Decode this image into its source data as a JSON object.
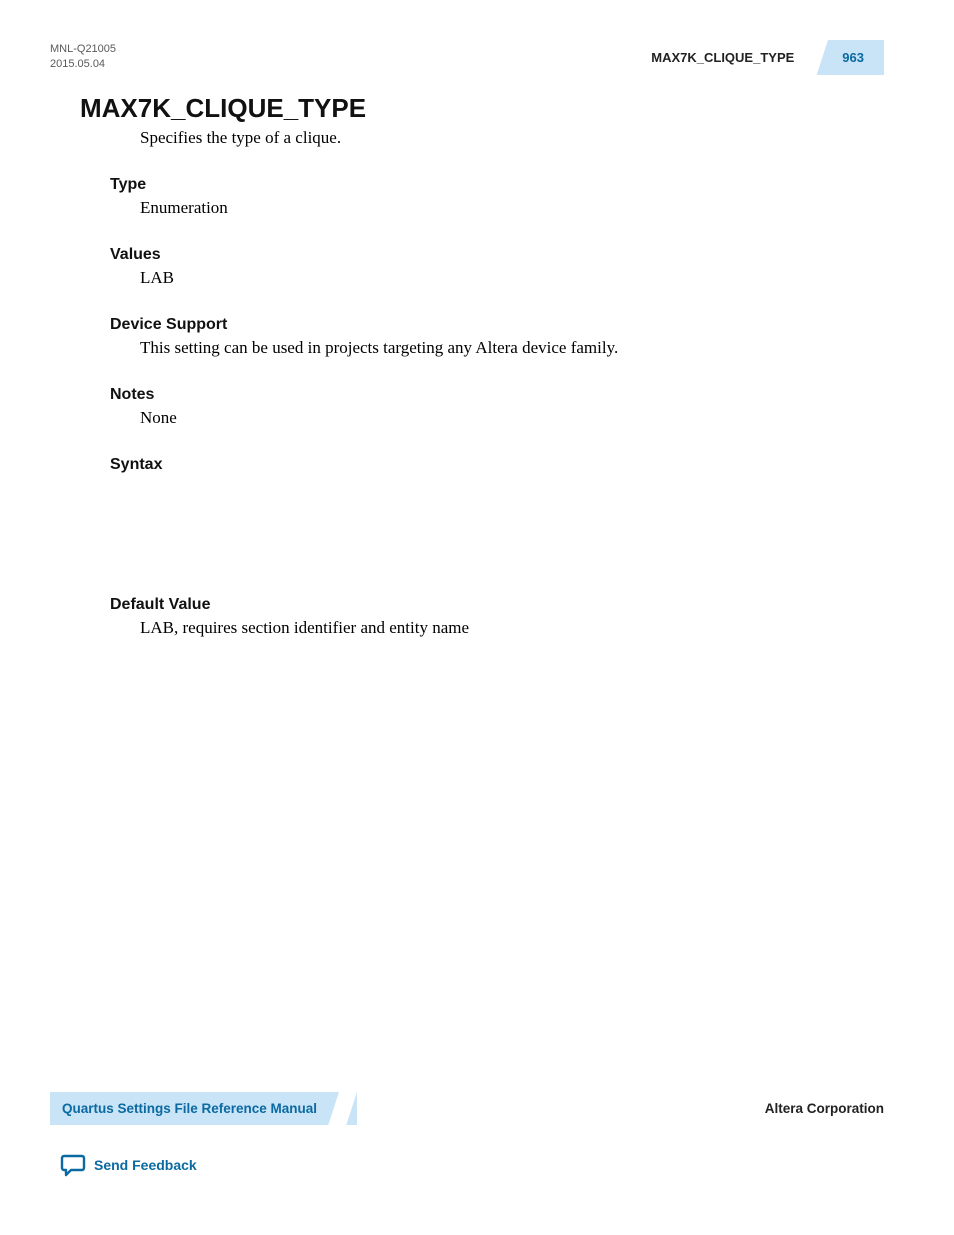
{
  "header": {
    "doc_id": "MNL-Q21005",
    "date": "2015.05.04",
    "running_title": "MAX7K_CLIQUE_TYPE",
    "page_number": "963"
  },
  "title": "MAX7K_CLIQUE_TYPE",
  "intro": "Specifies the type of a clique.",
  "sections": {
    "type": {
      "heading": "Type",
      "body": "Enumeration"
    },
    "values": {
      "heading": "Values",
      "body": "LAB"
    },
    "device_support": {
      "heading": "Device Support",
      "body": "This setting can be used in projects targeting any Altera device family."
    },
    "notes": {
      "heading": "Notes",
      "body": "None"
    },
    "syntax": {
      "heading": "Syntax",
      "body": ""
    },
    "default_value": {
      "heading": "Default Value",
      "body": "LAB, requires section identifier and entity name"
    }
  },
  "footer": {
    "manual_title": "Quartus Settings File Reference Manual",
    "company": "Altera Corporation",
    "feedback_label": "Send Feedback"
  }
}
